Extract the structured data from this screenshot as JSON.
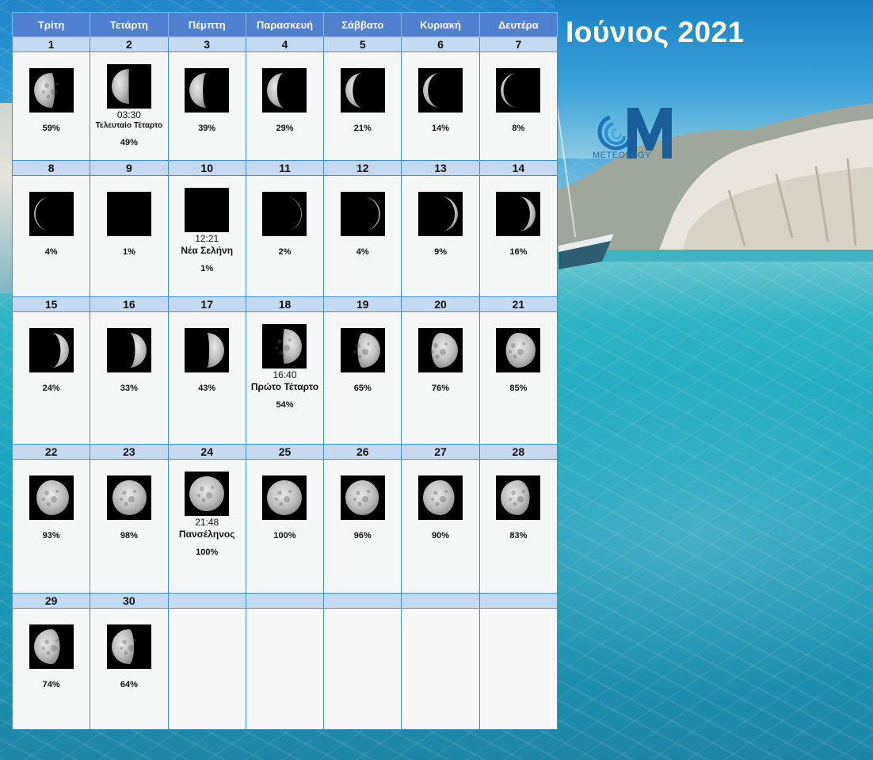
{
  "title": "Ιούνιος 2021",
  "logo_text": "METEOLOGY",
  "weekdays": [
    "Τρίτη",
    "Τετάρτη",
    "Πέμπτη",
    "Παρασκευή",
    "Σάββατο",
    "Κυριακή",
    "Δευτέρα"
  ],
  "weeks": [
    [
      {
        "day": "1",
        "pct": "59%",
        "illum": 0.59,
        "waxing": false
      },
      {
        "day": "2",
        "pct": "49%",
        "illum": 0.49,
        "waxing": false,
        "time": "03:30",
        "event": "Τελευταίο Τέταρτο"
      },
      {
        "day": "3",
        "pct": "39%",
        "illum": 0.39,
        "waxing": false
      },
      {
        "day": "4",
        "pct": "29%",
        "illum": 0.29,
        "waxing": false
      },
      {
        "day": "5",
        "pct": "21%",
        "illum": 0.21,
        "waxing": false
      },
      {
        "day": "6",
        "pct": "14%",
        "illum": 0.14,
        "waxing": false
      },
      {
        "day": "7",
        "pct": "8%",
        "illum": 0.08,
        "waxing": false
      }
    ],
    [
      {
        "day": "8",
        "pct": "4%",
        "illum": 0.04,
        "waxing": false
      },
      {
        "day": "9",
        "pct": "1%",
        "illum": 0.01,
        "waxing": false
      },
      {
        "day": "10",
        "pct": "1%",
        "illum": 0.0,
        "waxing": true,
        "time": "12:21",
        "event": "Νέα Σελήνη"
      },
      {
        "day": "11",
        "pct": "2%",
        "illum": 0.02,
        "waxing": true
      },
      {
        "day": "12",
        "pct": "4%",
        "illum": 0.04,
        "waxing": true
      },
      {
        "day": "13",
        "pct": "9%",
        "illum": 0.09,
        "waxing": true
      },
      {
        "day": "14",
        "pct": "16%",
        "illum": 0.16,
        "waxing": true
      }
    ],
    [
      {
        "day": "15",
        "pct": "24%",
        "illum": 0.24,
        "waxing": true
      },
      {
        "day": "16",
        "pct": "33%",
        "illum": 0.33,
        "waxing": true
      },
      {
        "day": "17",
        "pct": "43%",
        "illum": 0.43,
        "waxing": true
      },
      {
        "day": "18",
        "pct": "54%",
        "illum": 0.54,
        "waxing": true,
        "time": "16:40",
        "event": "Πρώτο Τέταρτο"
      },
      {
        "day": "19",
        "pct": "65%",
        "illum": 0.65,
        "waxing": true
      },
      {
        "day": "20",
        "pct": "76%",
        "illum": 0.76,
        "waxing": true
      },
      {
        "day": "21",
        "pct": "85%",
        "illum": 0.85,
        "waxing": true
      }
    ],
    [
      {
        "day": "22",
        "pct": "93%",
        "illum": 0.93,
        "waxing": true
      },
      {
        "day": "23",
        "pct": "98%",
        "illum": 0.98,
        "waxing": true
      },
      {
        "day": "24",
        "pct": "100%",
        "illum": 1.0,
        "waxing": true,
        "time": "21:48",
        "event": "Πανσέληνος"
      },
      {
        "day": "25",
        "pct": "100%",
        "illum": 1.0,
        "waxing": false
      },
      {
        "day": "26",
        "pct": "96%",
        "illum": 0.96,
        "waxing": false
      },
      {
        "day": "27",
        "pct": "90%",
        "illum": 0.9,
        "waxing": false
      },
      {
        "day": "28",
        "pct": "83%",
        "illum": 0.83,
        "waxing": false
      }
    ],
    [
      {
        "day": "29",
        "pct": "74%",
        "illum": 0.74,
        "waxing": false
      },
      {
        "day": "30",
        "pct": "64%",
        "illum": 0.64,
        "waxing": false
      },
      {
        "day": ""
      },
      {
        "day": ""
      },
      {
        "day": ""
      },
      {
        "day": ""
      },
      {
        "day": ""
      }
    ]
  ]
}
